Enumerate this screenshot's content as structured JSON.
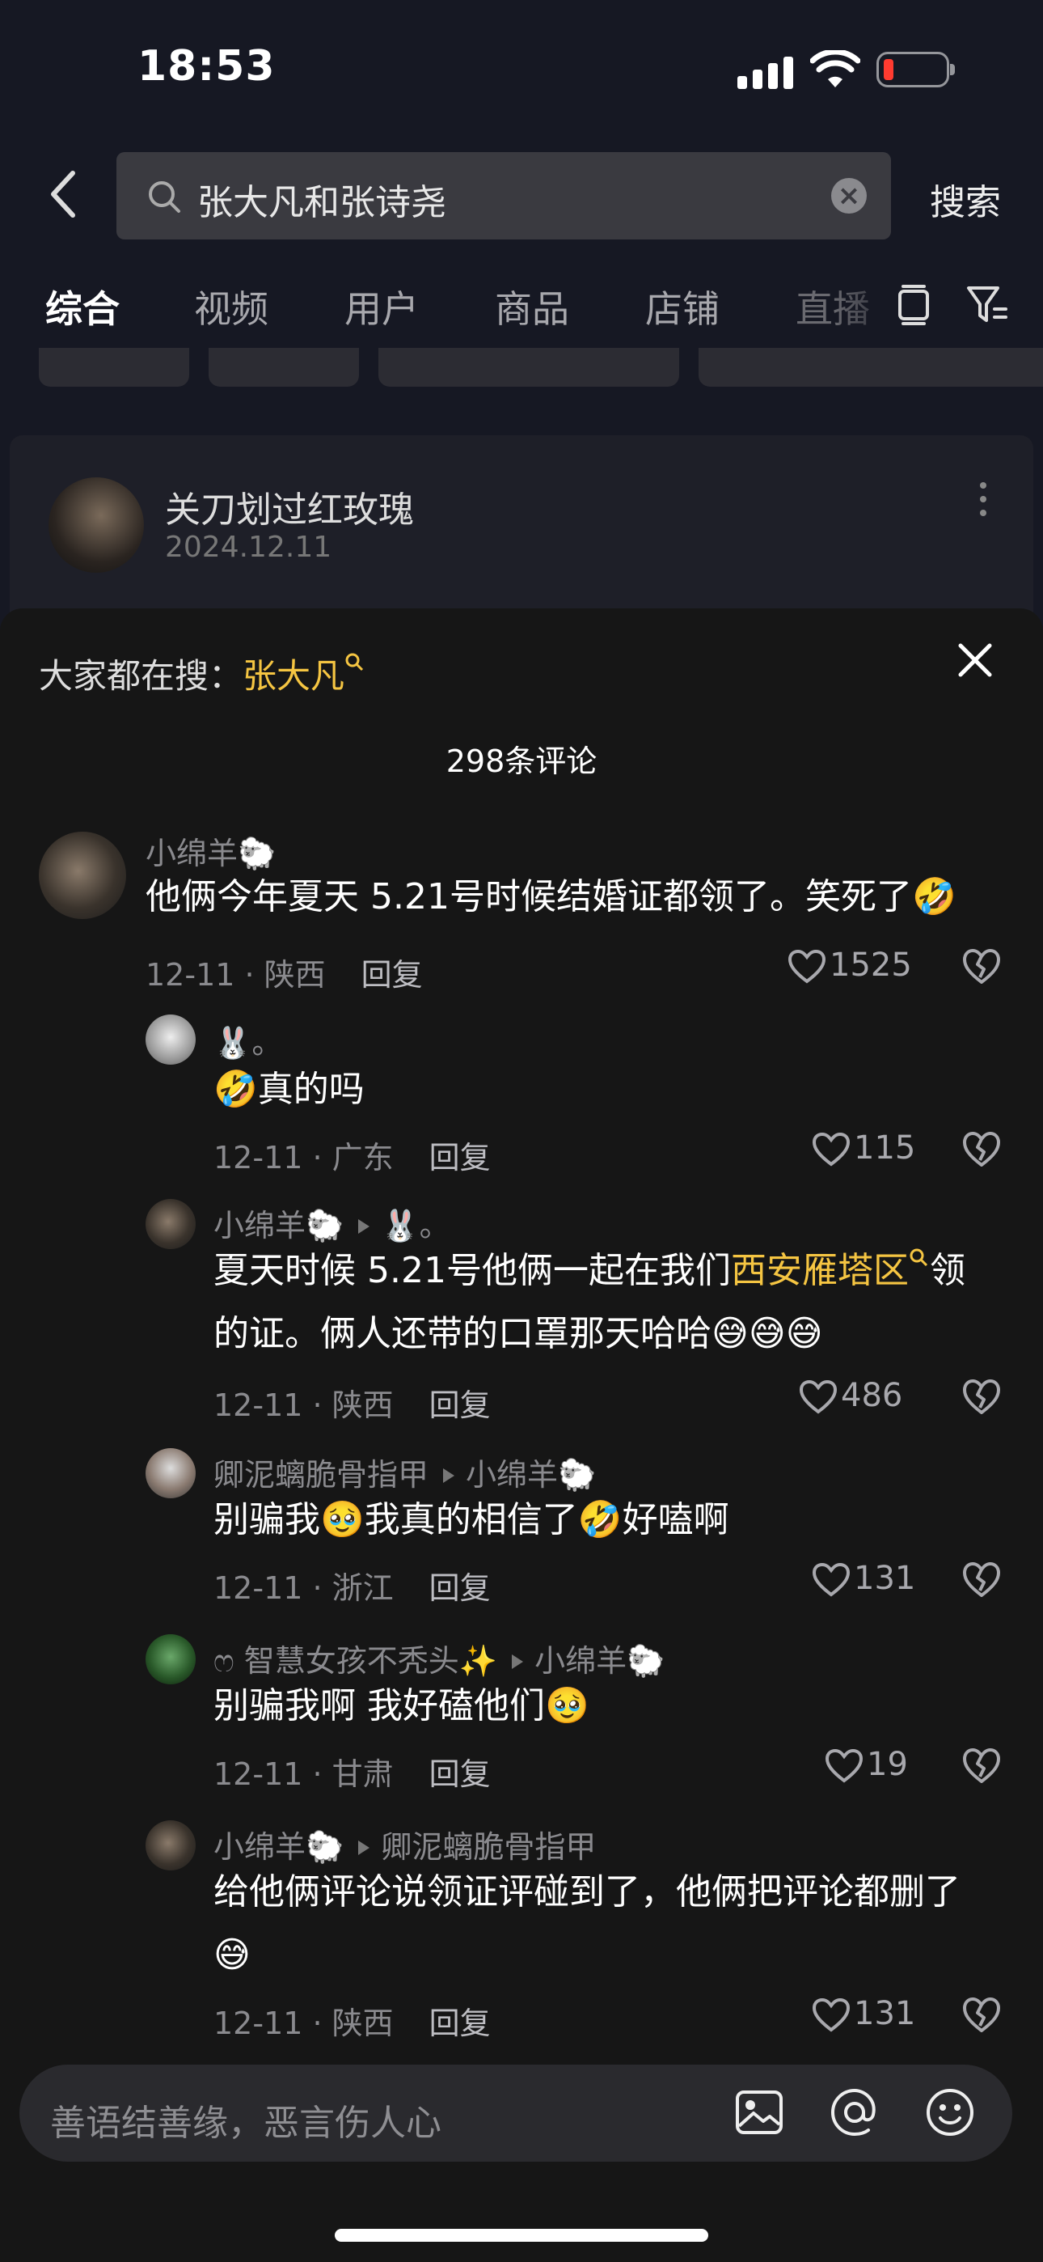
{
  "status_bar": {
    "time": "18:53"
  },
  "search": {
    "query": "张大凡和张诗尧",
    "button": "搜索"
  },
  "tabs": [
    "综合",
    "视频",
    "用户",
    "商品",
    "店铺",
    "直播"
  ],
  "post": {
    "author": "关刀划过红玫瑰",
    "date": "2024.12.11"
  },
  "sheet": {
    "hot_prefix": "大家都在搜：",
    "hot_keyword": "张大凡",
    "count": "298条评论"
  },
  "comments": [
    {
      "user": "小绵羊🐑",
      "text": "他俩今年夏天 5.21号时候结婚证都领了。笑死了🤣",
      "meta": "12-11 · 陕西",
      "reply": "回复",
      "likes": "1525"
    },
    {
      "user": "🐰。",
      "text": "🤣真的吗",
      "meta": "12-11 · 广东",
      "reply": "回复",
      "likes": "115"
    },
    {
      "user": "小绵羊🐑",
      "to": "🐰。",
      "text_a": "夏天时候 5.21号他俩一起在我们",
      "text_hl": "西安雁塔区",
      "text_b": "领",
      "text_line2": "的证。俩人还带的口罩那天哈哈😅😅😅",
      "meta": "12-11 · 陕西",
      "reply": "回复",
      "likes": "486"
    },
    {
      "user": "卿泥螭脆骨指甲",
      "to": "小绵羊🐑",
      "text": "别骗我🥹我真的相信了🤣好嗑啊",
      "meta": "12-11 · 浙江",
      "reply": "回复",
      "likes": "131"
    },
    {
      "user": "ෆ 智慧女孩不秃头✨",
      "to": "小绵羊🐑",
      "text": "别骗我啊 我好磕他们🥹",
      "meta": "12-11 · 甘肃",
      "reply": "回复",
      "likes": "19"
    },
    {
      "user": "小绵羊🐑",
      "to": "卿泥螭脆骨指甲",
      "text": "给他俩评论说领证评碰到了，他俩把评论都删了",
      "text_line2": "😅",
      "meta": "12-11 · 陕西",
      "reply": "回复",
      "likes": "131"
    }
  ],
  "input": {
    "placeholder": "善语结善缘，恶言伤人心"
  }
}
